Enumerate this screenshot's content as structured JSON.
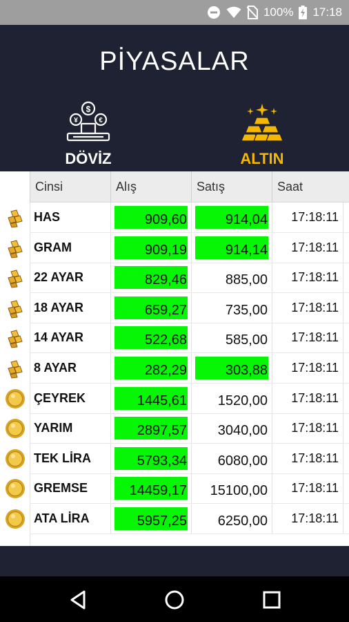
{
  "status": {
    "battery_percent": "100%",
    "time": "17:18"
  },
  "header": {
    "title": "PİYASALAR"
  },
  "tabs": [
    {
      "label": "DÖVİZ",
      "icon": "currency-exchange-icon",
      "active": false
    },
    {
      "label": "ALTIN",
      "icon": "gold-bars-icon",
      "active": true,
      "color": "#f5b800"
    }
  ],
  "table": {
    "columns": [
      "Cinsi",
      "Alış",
      "Satış",
      "Saat"
    ],
    "rows": [
      {
        "name": "HAS",
        "alis": "909,60",
        "satis": "914,04",
        "saat": "17:18:11",
        "alis_green": true,
        "satis_green": true,
        "icon": "gold-bar-icon"
      },
      {
        "name": "GRAM",
        "alis": "909,19",
        "satis": "914,14",
        "saat": "17:18:11",
        "alis_green": true,
        "satis_green": true,
        "icon": "gold-bar-icon"
      },
      {
        "name": "22 AYAR",
        "alis": "829,46",
        "satis": "885,00",
        "saat": "17:18:11",
        "alis_green": true,
        "satis_green": false,
        "icon": "gold-bar-icon"
      },
      {
        "name": "18 AYAR",
        "alis": "659,27",
        "satis": "735,00",
        "saat": "17:18:11",
        "alis_green": true,
        "satis_green": false,
        "icon": "gold-bar-icon"
      },
      {
        "name": "14 AYAR",
        "alis": "522,68",
        "satis": "585,00",
        "saat": "17:18:11",
        "alis_green": true,
        "satis_green": false,
        "icon": "gold-bar-icon"
      },
      {
        "name": "8 AYAR",
        "alis": "282,29",
        "satis": "303,88",
        "saat": "17:18:11",
        "alis_green": true,
        "satis_green": true,
        "icon": "gold-bar-icon"
      },
      {
        "name": "ÇEYREK",
        "alis": "1445,61",
        "satis": "1520,00",
        "saat": "17:18:11",
        "alis_green": true,
        "satis_green": false,
        "icon": "gold-coin-icon"
      },
      {
        "name": "YARIM",
        "alis": "2897,57",
        "satis": "3040,00",
        "saat": "17:18:11",
        "alis_green": true,
        "satis_green": false,
        "icon": "gold-coin-icon"
      },
      {
        "name": "TEK LİRA",
        "alis": "5793,34",
        "satis": "6080,00",
        "saat": "17:18:11",
        "alis_green": true,
        "satis_green": false,
        "icon": "gold-coin-icon"
      },
      {
        "name": "GREMSE",
        "alis": "14459,17",
        "satis": "15100,00",
        "saat": "17:18:11",
        "alis_green": true,
        "satis_green": false,
        "icon": "gold-coin-icon"
      },
      {
        "name": "ATA LİRA",
        "alis": "5957,25",
        "satis": "6250,00",
        "saat": "17:18:11",
        "alis_green": true,
        "satis_green": false,
        "icon": "gold-coin-icon"
      }
    ]
  },
  "colors": {
    "header_bg": "#1e2233",
    "highlight_green": "#06f606",
    "gold": "#f5b800"
  },
  "nav": [
    {
      "name": "back-icon"
    },
    {
      "name": "home-icon"
    },
    {
      "name": "recents-icon"
    }
  ]
}
